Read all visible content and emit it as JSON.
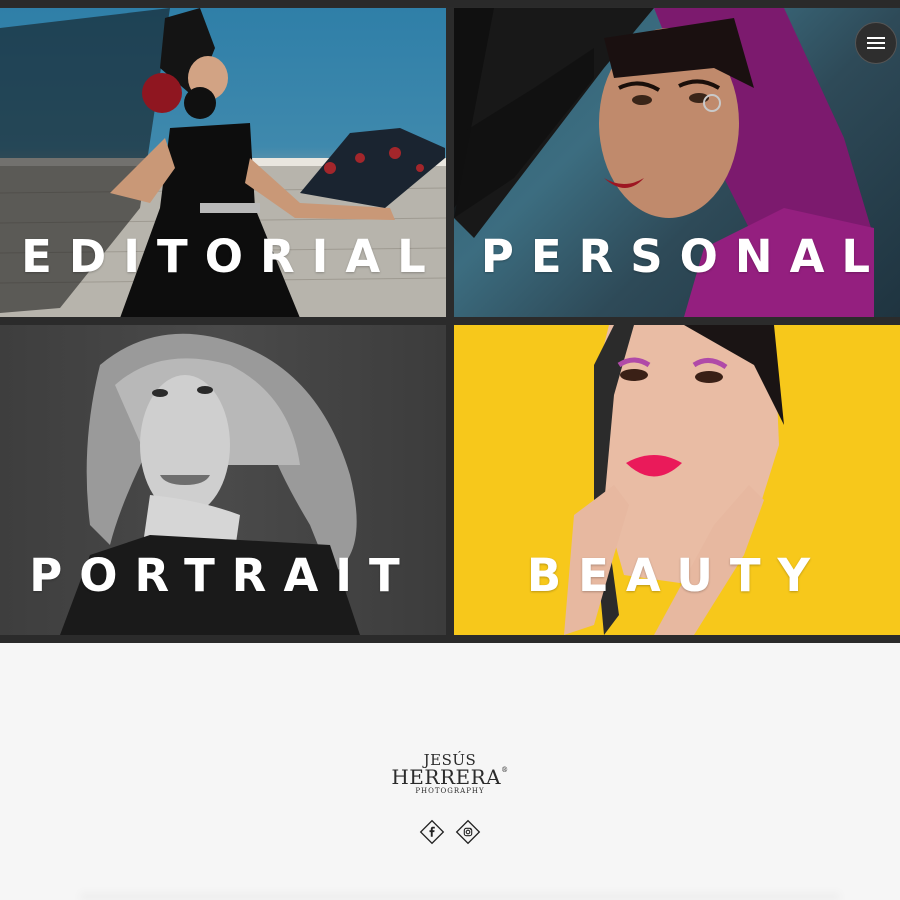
{
  "tiles": [
    {
      "label": "EDITORIAL"
    },
    {
      "label": "PERSONAL"
    },
    {
      "label": "PORTRAIT"
    },
    {
      "label": "BEAUTY"
    }
  ],
  "icons": {
    "menu": "hamburger-menu-icon",
    "facebook": "facebook-icon",
    "instagram": "instagram-icon"
  },
  "footer": {
    "logo_line1": "JESÚS",
    "logo_line2": "HERRERA",
    "logo_mark": "®",
    "logo_line3": "PHOTOGRAPHY"
  },
  "colors": {
    "beauty_bg": "#f7c81b",
    "grid_bg": "#2b2b2b",
    "footer_bg": "#f6f6f6"
  }
}
